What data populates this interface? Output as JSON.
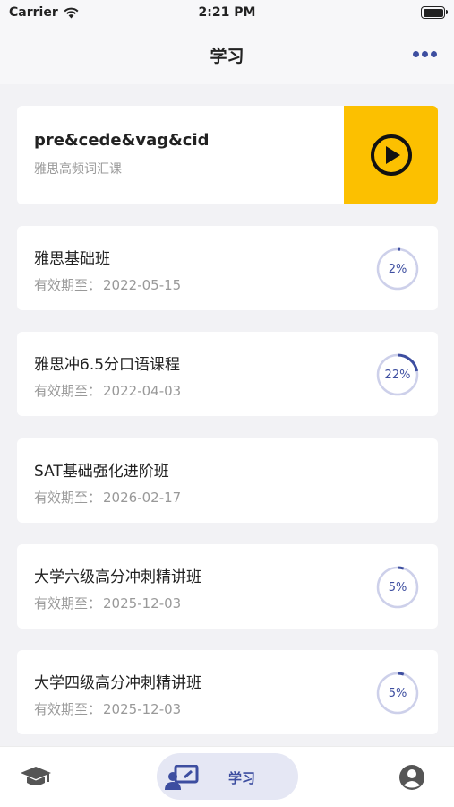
{
  "status_bar": {
    "carrier": "Carrier",
    "time": "2:21 PM"
  },
  "nav": {
    "title": "学习"
  },
  "colors": {
    "accent": "#3d4ea0",
    "play_bg": "#fcc000",
    "ring_track": "#cdd0ea"
  },
  "featured": {
    "word": "pre&cede&vag&cid",
    "subtitle": "雅思高频词汇课"
  },
  "courses": [
    {
      "title": "雅思基础班",
      "expire_label": "有效期至：",
      "expire_date": "2022-05-15",
      "progress_text": "2%",
      "progress": 0.02
    },
    {
      "title": "雅思冲6.5分口语课程",
      "expire_label": "有效期至：",
      "expire_date": "2022-04-03",
      "progress_text": "22%",
      "progress": 0.22
    },
    {
      "title": "SAT基础强化进阶班",
      "expire_label": "有效期至：",
      "expire_date": "2026-02-17",
      "progress_text": "",
      "progress": null
    },
    {
      "title": "大学六级高分冲刺精讲班",
      "expire_label": "有效期至：",
      "expire_date": "2025-12-03",
      "progress_text": "5%",
      "progress": 0.05
    },
    {
      "title": "大学四级高分冲刺精讲班",
      "expire_label": "有效期至：",
      "expire_date": "2025-12-03",
      "progress_text": "5%",
      "progress": 0.05
    }
  ],
  "tabs": {
    "study_label": "学习"
  }
}
